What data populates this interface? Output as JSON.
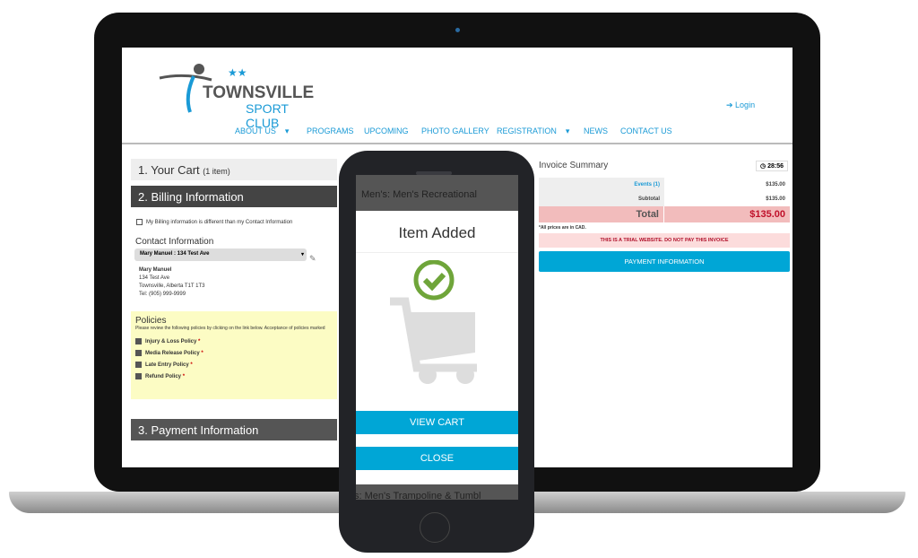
{
  "site": {
    "logo_line1": "TOWNSVILLE",
    "logo_line2": "SPORT CLUB",
    "login": "Login",
    "nav": [
      "ABOUT US",
      "PROGRAMS",
      "UPCOMING",
      "PHOTO GALLERY",
      "REGISTRATION",
      "NEWS",
      "CONTACT US"
    ]
  },
  "cart": {
    "step1": "1. Your Cart",
    "step1_count": "(1 item)",
    "step2": "2. Billing Information",
    "billing_diff": "My Billing information is different than my Contact Information",
    "contact_heading": "Contact Information",
    "contact_select": "Mary Manuel : 134 Test Ave",
    "address": [
      "Mary Manuel",
      "134 Test Ave",
      "Townsville, Alberta T1T 1T3",
      "Tel: (905) 999-9999"
    ],
    "policies_heading": "Policies",
    "policies_text": "Please review the following policies by clicking on the link below. Acceptance of policies marked",
    "policies": [
      "Injury & Loss Policy",
      "Media Release Policy",
      "Late Entry Policy",
      "Refund Policy"
    ],
    "step3": "3. Payment Information"
  },
  "invoice": {
    "title": "Invoice Summary",
    "timer": "28:56",
    "events_label": "Events (1)",
    "events_value": "$135.00",
    "subtotal_label": "Subtotal",
    "subtotal_value": "$135.00",
    "total_label": "Total",
    "total_value": "$135.00",
    "cad_note": "*All prices are in CAD.",
    "trial_warning": "THIS IS A TRIAL WEBSITE. DO NOT PAY THIS INVOICE",
    "payment_button": "PAYMENT INFORMATION"
  },
  "phone": {
    "bg_top": "Men's: Men's Recreational",
    "bg_bottom": "s: Men's Trampoline & Tumbl",
    "modal_title": "Item Added",
    "view_cart": "VIEW CART",
    "close": "CLOSE"
  },
  "colors": {
    "accent": "#00a6d6",
    "success": "#6fa53a",
    "total_bg": "#f2bcbc",
    "total_text": "#c0102a"
  }
}
